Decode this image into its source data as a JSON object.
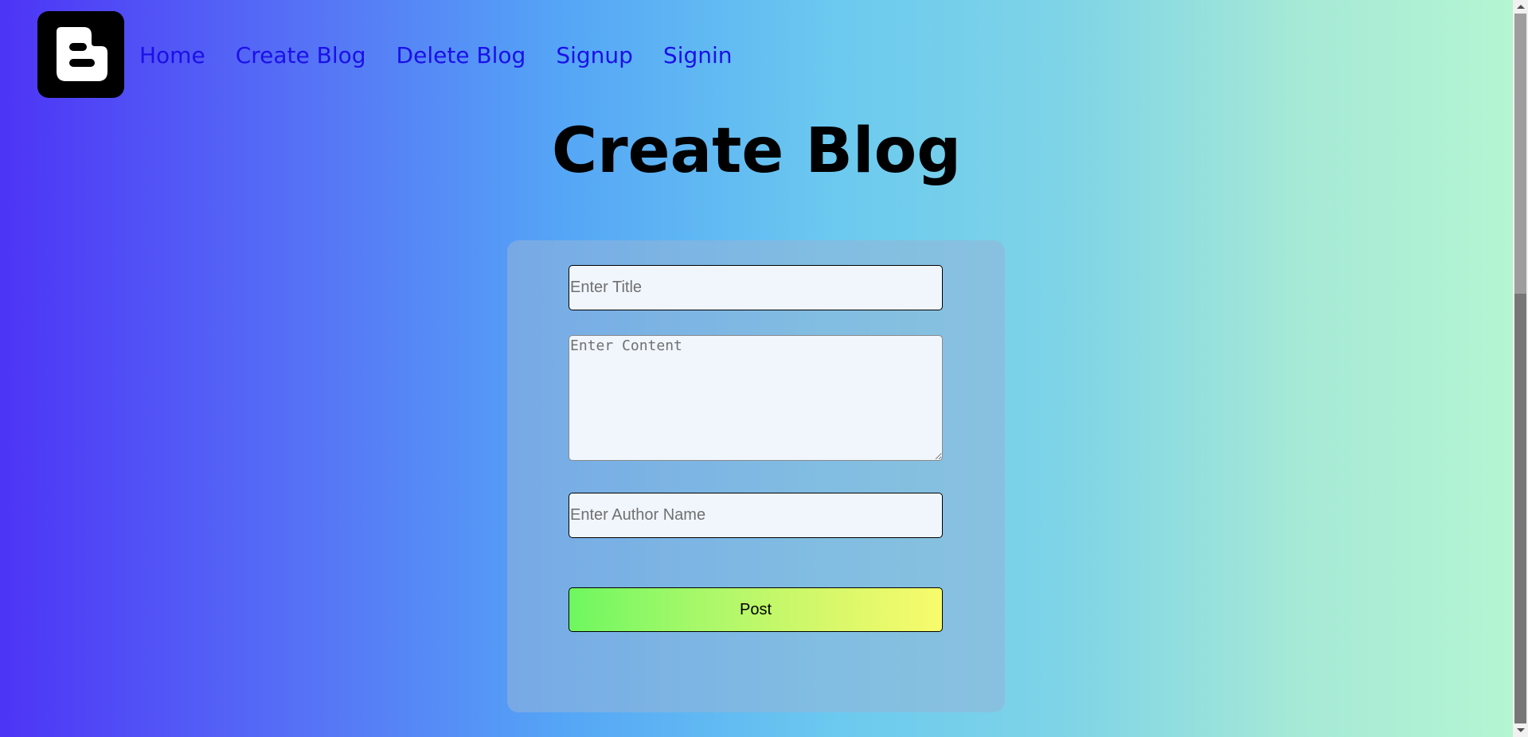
{
  "nav": {
    "items": [
      {
        "label": "Home"
      },
      {
        "label": "Create Blog"
      },
      {
        "label": "Delete Blog"
      },
      {
        "label": "Signup"
      },
      {
        "label": "Signin"
      }
    ]
  },
  "logo": {
    "icon": "blogger-logo-icon"
  },
  "page": {
    "title": "Create Blog"
  },
  "form": {
    "title_placeholder": "Enter Title",
    "content_placeholder": "Enter Content",
    "author_placeholder": "Enter Author Name",
    "post_label": "Post"
  },
  "colors": {
    "nav_link": "#1b10e8",
    "button_gradient_start": "#6ef760",
    "button_gradient_end": "#f8fb6c"
  }
}
